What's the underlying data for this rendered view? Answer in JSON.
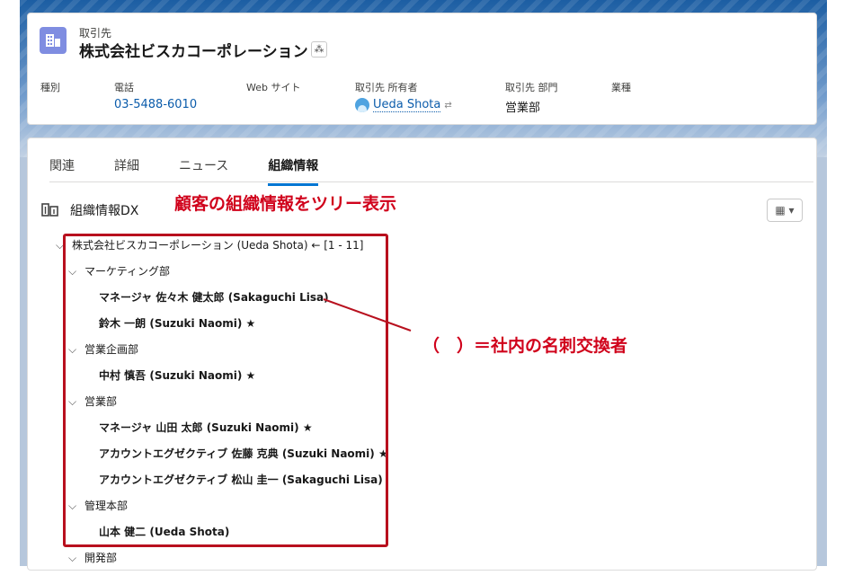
{
  "header": {
    "object_label": "取引先",
    "record_name": "株式会社ビスカコーポレーション",
    "fields": [
      {
        "label": "種別",
        "value": ""
      },
      {
        "label": "電話",
        "value": "03-5488-6010"
      },
      {
        "label": "Web サイト",
        "value": ""
      },
      {
        "label": "取引先 所有者",
        "value": "Ueda Shota"
      },
      {
        "label": "取引先 部門",
        "value": "営業部"
      },
      {
        "label": "業種",
        "value": ""
      }
    ]
  },
  "tabs": [
    {
      "label": "関連",
      "active": false
    },
    {
      "label": "詳細",
      "active": false
    },
    {
      "label": "ニュース",
      "active": false
    },
    {
      "label": "組織情報",
      "active": true
    }
  ],
  "section": {
    "title": "組織情報DX",
    "annotation": "顧客の組織情報をツリー表示"
  },
  "tree": {
    "root": "株式会社ビスカコーポレーション (Ueda Shota) ← [1 - 11]",
    "rows": [
      "マーケティング部",
      "マネージャ 佐々木 健太郎 (Sakaguchi Lisa)",
      "鈴木 一朗 (Suzuki Naomi) ★",
      "営業企画部",
      "中村 慎吾 (Suzuki Naomi) ★",
      "営業部",
      "マネージャ 山田 太郎 (Suzuki Naomi) ★",
      "アカウントエグゼクティブ 佐藤 克典 (Suzuki Naomi) ★",
      "アカウントエグゼクティブ 松山 圭一 (Sakaguchi Lisa)",
      "管理本部",
      "山本 健二 (Ueda Shota)",
      "開発部"
    ]
  },
  "annotation_note": "（　）＝社内の名刺交換者",
  "colors": {
    "accent": "#0176d3",
    "link": "#0b5cab",
    "annotation_red": "#d0021b",
    "box_red": "#b8101e",
    "object_icon": "#7f8de1"
  },
  "icons": [
    "account-building-icon",
    "hierarchy-icon",
    "user-avatar-icon",
    "change-owner-icon",
    "org-building-icon",
    "table-view-icon",
    "chevron-down-icon"
  ]
}
